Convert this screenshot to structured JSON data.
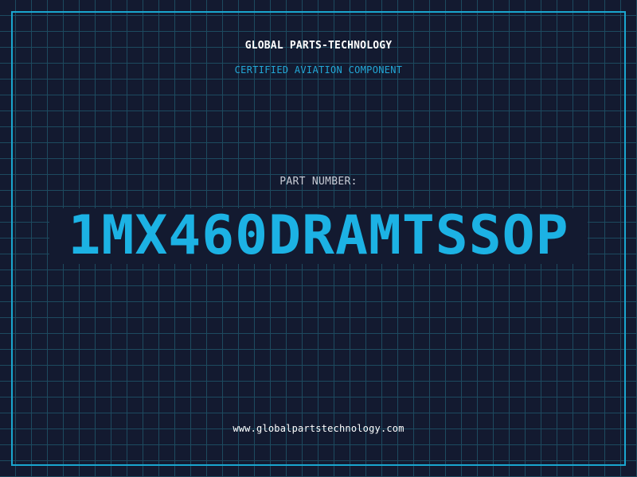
{
  "header": {
    "company": "GLOBAL PARTS-TECHNOLOGY",
    "subtitle": "CERTIFIED AVIATION COMPONENT"
  },
  "part": {
    "label": "PART NUMBER:",
    "number": "1MX460DRAMTSSOP"
  },
  "footer": {
    "website": "www.globalpartstechnology.com"
  },
  "colors": {
    "background": "#131a30",
    "grid": "#1d4a5f",
    "accent": "#1cb2e4",
    "border": "#1aa6cf"
  }
}
